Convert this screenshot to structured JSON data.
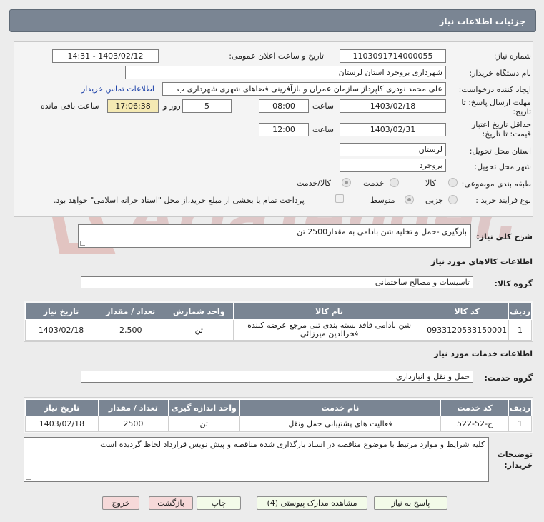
{
  "header": {
    "title": "جزئیات اطلاعات نیاز"
  },
  "form": {
    "need_number_label": "شماره نیاز:",
    "need_number": "1103091714000055",
    "announce_label": "تاریخ و ساعت اعلان عمومی:",
    "announce_value": "1403/02/12 - 14:31",
    "buyer_org_label": "نام دستگاه خریدار:",
    "buyer_org": "شهرداری بروجرد استان لرستان",
    "creator_label": "ایجاد کننده درخواست:",
    "creator": "علی محمد نودری کاپرداز سازمان عمران و بازآفرینی فضاهای شهری شهرداری ب",
    "contact_link": "اطلاعات تماس خریدار",
    "deadline_label_1": "مهلت ارسال پاسخ: تا",
    "deadline_label_2": "تاریخ:",
    "deadline_date": "1403/02/18",
    "time_label": "ساعت",
    "deadline_time": "08:00",
    "days_value": "5",
    "days_label": "روز و",
    "remaining_time": "17:06:38",
    "remaining_label": "ساعت باقی مانده",
    "validity_label_1": "حداقل تاریخ اعتبار",
    "validity_label_2": "قیمت: تا تاریخ:",
    "validity_date": "1403/02/31",
    "validity_time_label": "ساعت",
    "validity_time": "12:00",
    "province_label": "استان محل تحویل:",
    "province": "لرستان",
    "city_label": "شهر محل تحویل:",
    "city": "بروجرد",
    "category_label": "طبقه بندی موضوعی:",
    "category_options": [
      "کالا",
      "خدمت",
      "کالا/خدمت"
    ],
    "process_label": "نوع فرآیند خرید :",
    "process_options": [
      "جزیی",
      "متوسط"
    ],
    "payment_note": "پرداخت تمام یا بخشی از مبلغ خرید،از محل \"اسناد خزانه اسلامی\" خواهد بود."
  },
  "description": {
    "label": "شرح کلي نياز:",
    "value": "بارگیری -حمل و تخلیه شن بادامی به مقدار2500 تن"
  },
  "goods": {
    "section_title": "اطلاعات کالاهای مورد نیاز",
    "group_label": "گروه کالا:",
    "group_value": "تاسیسات و مصالح ساختمانی",
    "columns": [
      "ردیف",
      "کد کالا",
      "نام کالا",
      "واحد شمارش",
      "تعداد / مقدار",
      "تاریخ نیاز"
    ],
    "rows": [
      [
        "1",
        "0933120533150001",
        "شن بادامی فاقد بسته بندی تنی مرجع عرضه کننده فخرالدین میرزائی",
        "تن",
        "2,500",
        "1403/02/18"
      ]
    ]
  },
  "services": {
    "section_title": "اطلاعات خدمات مورد نیاز",
    "group_label": "گروه خدمت:",
    "group_value": "حمل و نقل و انبارداری",
    "columns": [
      "ردیف",
      "کد خدمت",
      "نام خدمت",
      "واحد اندازه گیری",
      "تعداد / مقدار",
      "تاریخ نیاز"
    ],
    "rows": [
      [
        "1",
        "ح-52-522",
        "فعالیت های پشتیبانی حمل ونقل",
        "تن",
        "2500",
        "1403/02/18"
      ]
    ]
  },
  "buyer_notes": {
    "label_1": "توضیحات",
    "label_2": "خریدار:",
    "value": "کلیه شرایط و موارد مرتبط با موضوع مناقصه در اسناد بارگذاری شده مناقصه و پیش نویس قرارداد لحاظ گردیده است"
  },
  "buttons": {
    "reply": "پاسخ به نیاز",
    "attachments": "مشاهده مدارک پیوستی (4)",
    "print": "چاپ",
    "back": "بازگشت",
    "exit": "خروج"
  },
  "watermark": {
    "text": "AriaTender.net"
  },
  "colors": {
    "header_bg": "#7a8593",
    "link": "#1a3fa8",
    "remaining_bg": "#f4e9b3"
  }
}
